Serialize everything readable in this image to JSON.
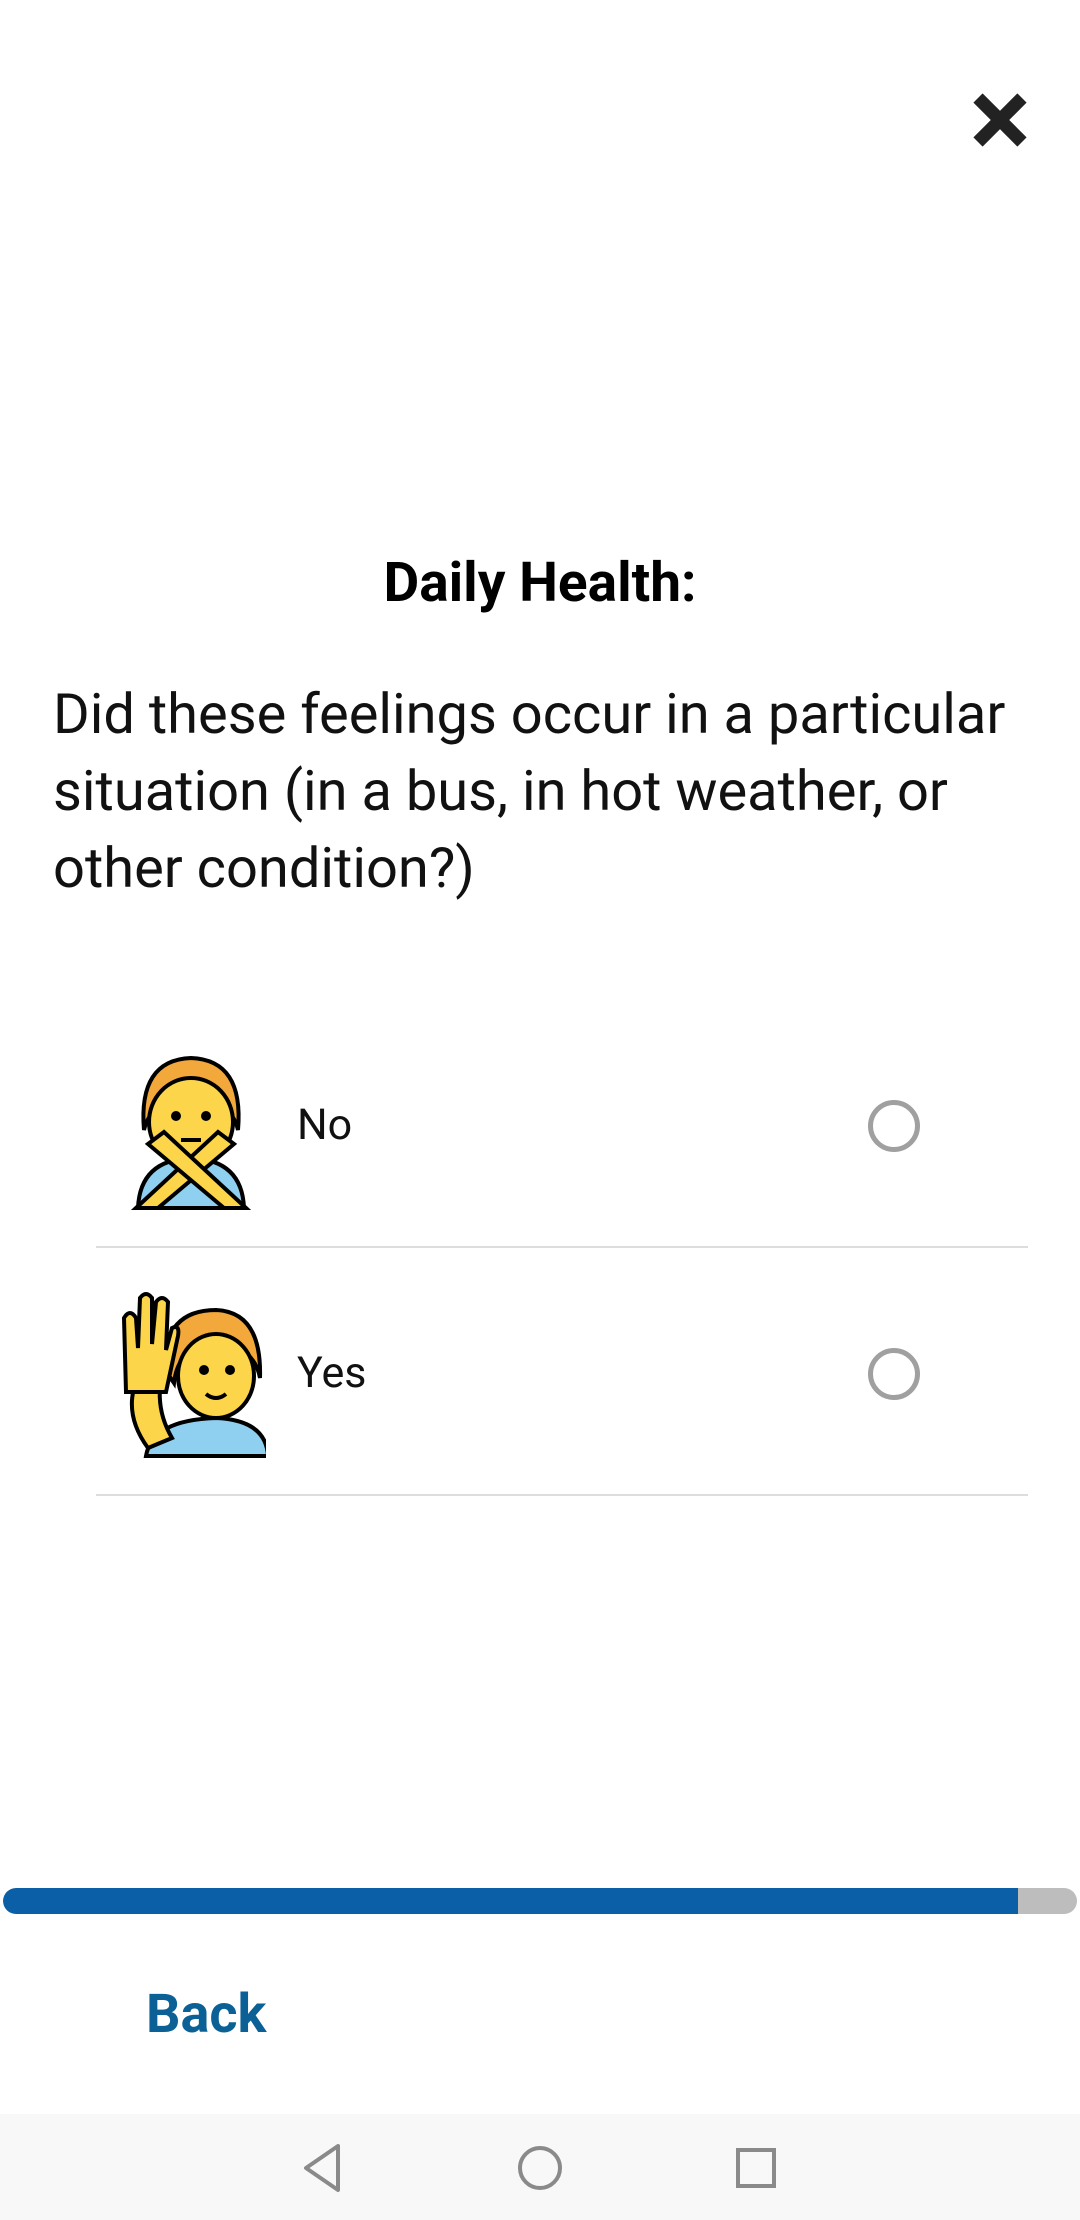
{
  "header": {
    "close_icon": "close-icon"
  },
  "survey": {
    "section_title": "Daily Health:",
    "question": "Did these feelings occur in a particular situation (in a bus, in hot weather, or other condition?)",
    "options": [
      {
        "label": "No",
        "icon": "person-gesturing-no-icon",
        "selected": false
      },
      {
        "label": "Yes",
        "icon": "person-raising-hand-icon",
        "selected": false
      }
    ]
  },
  "progress": {
    "percent": 94.5,
    "fill_color": "#0a5fa6",
    "track_color": "#bdbdbd"
  },
  "footer": {
    "back_label": "Back",
    "back_color": "#0b6196"
  },
  "navbar": {
    "back_icon": "nav-back-icon",
    "home_icon": "nav-home-icon",
    "recents_icon": "nav-recents-icon"
  }
}
